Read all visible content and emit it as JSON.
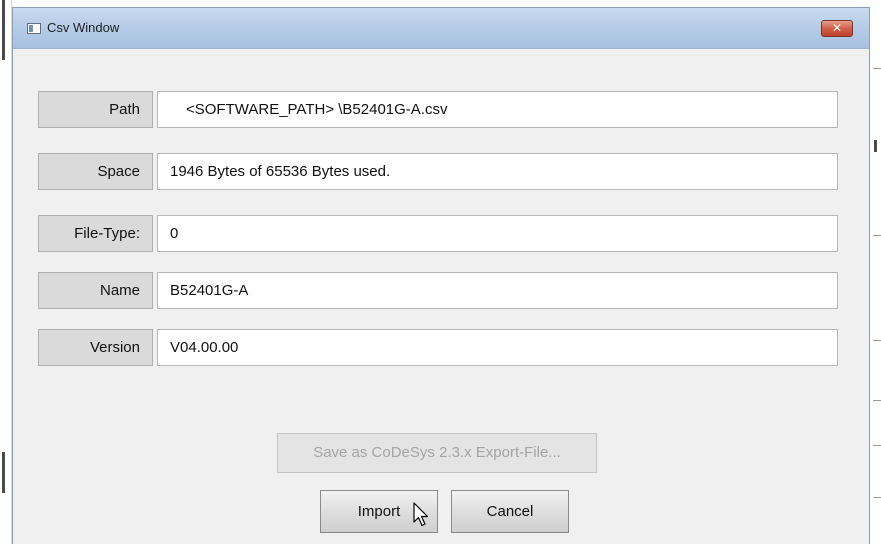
{
  "window": {
    "title": "Csv Window",
    "close_symbol": "✕",
    "icons": [
      "window-app-icon",
      "close-icon"
    ]
  },
  "fields": [
    {
      "label": "Path",
      "value": "<SOFTWARE_PATH> \\B52401G-A.csv"
    },
    {
      "label": "Space",
      "value": "1946 Bytes of 65536 Bytes used."
    },
    {
      "label": "File-Type:",
      "value": "0"
    },
    {
      "label": "Name",
      "value": "B52401G-A"
    },
    {
      "label": "Version",
      "value": "V04.00.00"
    }
  ],
  "buttons": {
    "export_label": "Save as CoDeSys 2.3.x Export-File...",
    "export_enabled": false,
    "import_label": "Import",
    "cancel_label": "Cancel"
  },
  "cursor": {
    "icon": "mouse-pointer-icon",
    "hovering": "import-button"
  }
}
